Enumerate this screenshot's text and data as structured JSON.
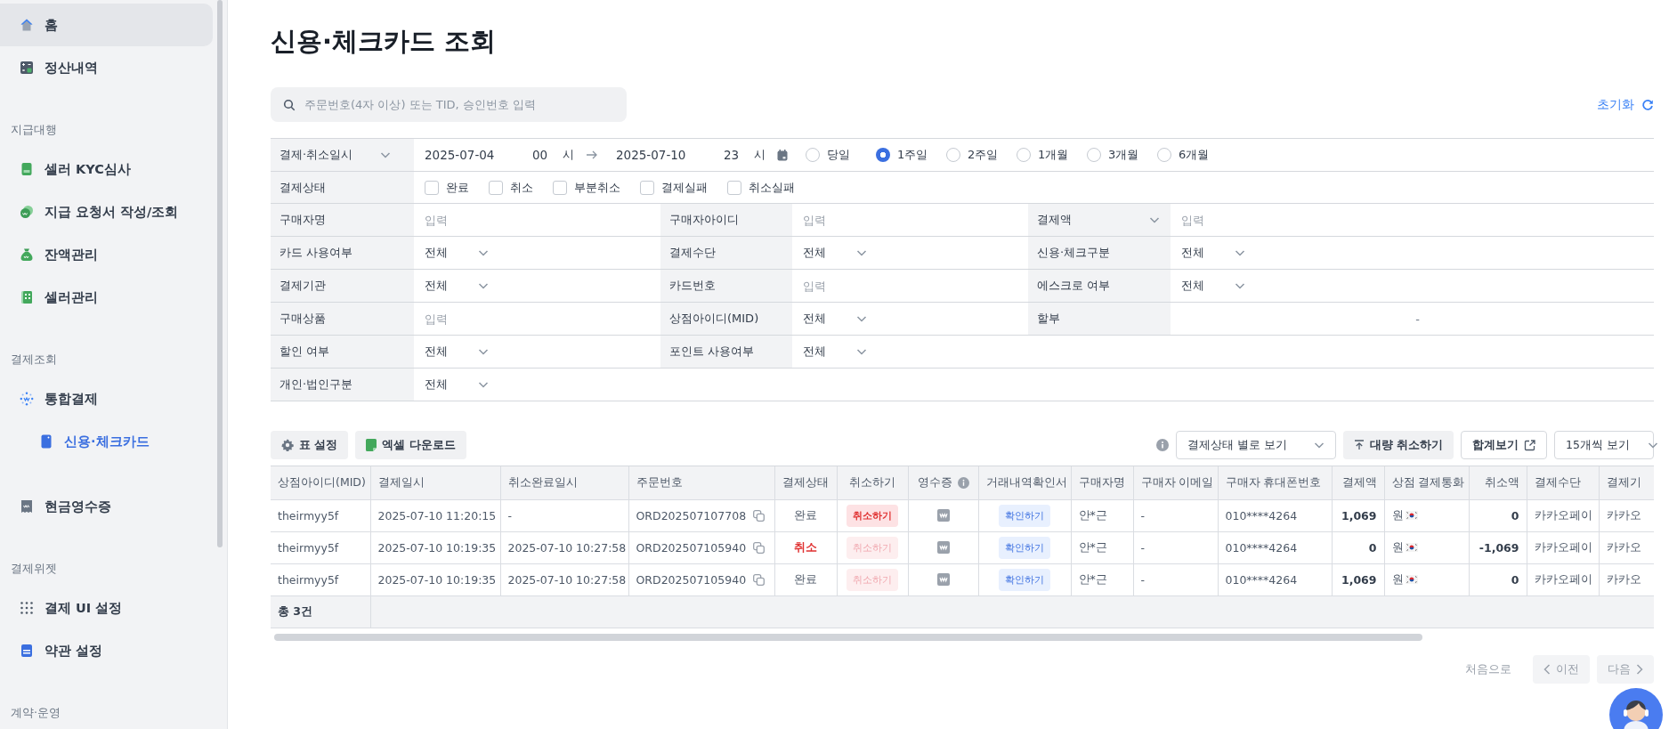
{
  "sidebar": {
    "items": [
      {
        "kind": "item",
        "label": "홈",
        "selected": true
      },
      {
        "kind": "item",
        "label": "정산내역",
        "selected": false
      },
      {
        "kind": "section",
        "label": "지급대행"
      },
      {
        "kind": "item",
        "label": "셀러 KYC심사",
        "selected": false
      },
      {
        "kind": "item",
        "label": "지급 요청서 작성/조회",
        "selected": false
      },
      {
        "kind": "item",
        "label": "잔액관리",
        "selected": false
      },
      {
        "kind": "item",
        "label": "셀러관리",
        "selected": false
      },
      {
        "kind": "section",
        "label": "결제조회"
      },
      {
        "kind": "item",
        "label": "통합결제",
        "selected": false,
        "children": [
          {
            "kind": "item",
            "label": "신용·체크카드",
            "selected": true
          }
        ]
      },
      {
        "kind": "item",
        "label": "현금영수증",
        "selected": false
      },
      {
        "kind": "section",
        "label": "결제위젯"
      },
      {
        "kind": "item",
        "label": "결제 UI 설정",
        "selected": false
      },
      {
        "kind": "item",
        "label": "약관 설정",
        "selected": false
      },
      {
        "kind": "section",
        "label": "계약·운영"
      }
    ]
  },
  "page_title": "신용·체크카드 조회",
  "search": {
    "placeholder": "주문번호(4자 이상) 또는 TID, 승인번호 입력"
  },
  "reset_button": "초기화",
  "filters": {
    "period": {
      "label": "결제·취소일시",
      "label_dropdown": true,
      "start_date": "2025-07-04",
      "start_hour": "00",
      "start_hour_unit": "시",
      "end_date": "2025-07-10",
      "end_hour": "23",
      "end_hour_unit": "시",
      "presets": [
        {
          "label": "당일",
          "selected": false
        },
        {
          "label": "1주일",
          "selected": true
        },
        {
          "label": "2주일",
          "selected": false
        },
        {
          "label": "1개월",
          "selected": false
        },
        {
          "label": "3개월",
          "selected": false
        },
        {
          "label": "6개월",
          "selected": false
        }
      ]
    },
    "status": {
      "label": "결제상태",
      "options": [
        {
          "label": "완료",
          "checked": false
        },
        {
          "label": "취소",
          "checked": false
        },
        {
          "label": "부분취소",
          "checked": false
        },
        {
          "label": "결제실패",
          "checked": false
        },
        {
          "label": "취소실패",
          "checked": false
        }
      ]
    },
    "rows": [
      [
        {
          "label": "구매자명",
          "label_dropdown": false,
          "kind": "input",
          "placeholder": "입력"
        },
        {
          "label": "구매자아이디",
          "label_dropdown": false,
          "kind": "input",
          "placeholder": "입력"
        },
        {
          "label": "결제액",
          "label_dropdown": true,
          "kind": "input",
          "placeholder": "입력"
        }
      ],
      [
        {
          "label": "카드 사용여부",
          "label_dropdown": false,
          "kind": "select",
          "value": "전체"
        },
        {
          "label": "결제수단",
          "label_dropdown": false,
          "kind": "select",
          "value": "전체"
        },
        {
          "label": "신용·체크구분",
          "label_dropdown": false,
          "kind": "select",
          "value": "전체"
        }
      ],
      [
        {
          "label": "결제기관",
          "label_dropdown": false,
          "kind": "select",
          "value": "전체"
        },
        {
          "label": "카드번호",
          "label_dropdown": false,
          "kind": "input",
          "placeholder": "입력"
        },
        {
          "label": "에스크로 여부",
          "label_dropdown": false,
          "kind": "select",
          "value": "전체"
        }
      ],
      [
        {
          "label": "구매상품",
          "label_dropdown": false,
          "kind": "input",
          "placeholder": "입력"
        },
        {
          "label": "상점아이디(MID)",
          "label_dropdown": false,
          "kind": "select",
          "value": "전체"
        },
        {
          "label": "할부",
          "label_dropdown": false,
          "kind": "text",
          "value": "-"
        }
      ],
      [
        {
          "label": "할인 여부",
          "label_dropdown": false,
          "kind": "select",
          "value": "전체"
        },
        {
          "label": "포인트 사용여부",
          "label_dropdown": false,
          "kind": "select",
          "value": "전체"
        }
      ],
      [
        {
          "label": "개인·법인구분",
          "label_dropdown": false,
          "kind": "select",
          "value": "전체"
        }
      ]
    ]
  },
  "toolbar": {
    "table_settings": "표 설정",
    "excel_download": "엑셀 다운로드",
    "view_select": "결제상태 별로 보기",
    "bulk_cancel": "대량 취소하기",
    "summary": "합계보기",
    "page_size": "15개씩 보기"
  },
  "table": {
    "columns": [
      {
        "label": "상점아이디(MID)",
        "info": false
      },
      {
        "label": "결제일시",
        "info": false
      },
      {
        "label": "취소완료일시",
        "info": false
      },
      {
        "label": "주문번호",
        "info": false
      },
      {
        "label": "결제상태",
        "info": false
      },
      {
        "label": "취소하기",
        "info": false
      },
      {
        "label": "영수증",
        "info": true
      },
      {
        "label": "거래내역확인서",
        "info": false
      },
      {
        "label": "구매자명",
        "info": false
      },
      {
        "label": "구매자 이메일",
        "info": false
      },
      {
        "label": "구매자 휴대폰번호",
        "info": false
      },
      {
        "label": "결제액",
        "info": false
      },
      {
        "label": "상점 결제통화",
        "info": false
      },
      {
        "label": "취소액",
        "info": false
      },
      {
        "label": "결제수단",
        "info": false
      },
      {
        "label": "결제기",
        "info": false
      }
    ],
    "rows": [
      {
        "mid": "theirmyy5f",
        "paid_at": "2025-07-10  11:20:15",
        "canceled_at": "-",
        "order_no": "ORD202507107708",
        "status": {
          "label": "완료",
          "canceled": false
        },
        "cancel_button": {
          "label": "취소하기",
          "disabled": false
        },
        "statement_button": "확인하기",
        "buyer_name": "안*근",
        "buyer_email": "-",
        "phone": "010****4264",
        "amount": "1,069",
        "currency": "원",
        "cancel_amount": "0",
        "method": "카카오페이",
        "institution": "카카오"
      },
      {
        "mid": "theirmyy5f",
        "paid_at": "2025-07-10  10:19:35",
        "canceled_at": "2025-07-10  10:27:58",
        "order_no": "ORD202507105940",
        "status": {
          "label": "취소",
          "canceled": true
        },
        "cancel_button": {
          "label": "취소하기",
          "disabled": true
        },
        "statement_button": "확인하기",
        "buyer_name": "안*근",
        "buyer_email": "-",
        "phone": "010****4264",
        "amount": "0",
        "currency": "원",
        "cancel_amount": "-1,069",
        "method": "카카오페이",
        "institution": "카카오"
      },
      {
        "mid": "theirmyy5f",
        "paid_at": "2025-07-10  10:19:35",
        "canceled_at": "2025-07-10  10:27:58",
        "order_no": "ORD202507105940",
        "status": {
          "label": "완료",
          "canceled": false
        },
        "cancel_button": {
          "label": "취소하기",
          "disabled": true
        },
        "statement_button": "확인하기",
        "buyer_name": "안*근",
        "buyer_email": "-",
        "phone": "010****4264",
        "amount": "1,069",
        "currency": "원",
        "cancel_amount": "0",
        "method": "카카오페이",
        "institution": "카카오"
      }
    ],
    "total": "총 3건"
  },
  "pagination": {
    "first": {
      "label": "처음으로",
      "disabled": true
    },
    "prev": {
      "label": "이전",
      "disabled": true
    },
    "next": {
      "label": "다음",
      "disabled": true
    }
  }
}
